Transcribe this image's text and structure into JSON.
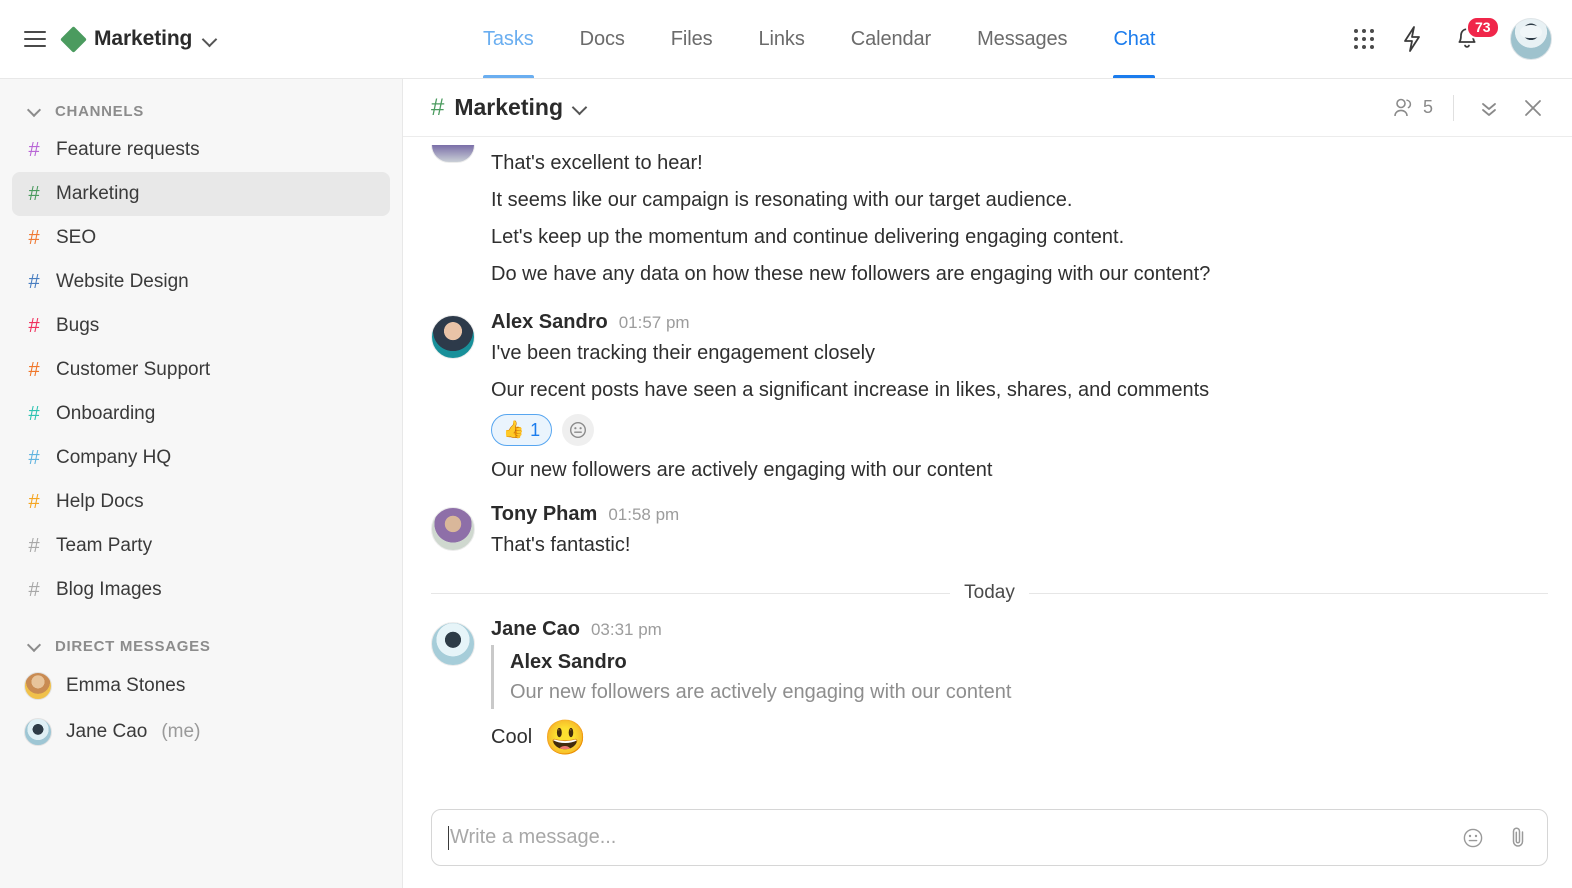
{
  "topbar": {
    "menu_icon": "hamburger-icon",
    "workspace": "Marketing",
    "workspace_caret": "chevron-down-icon",
    "tabs": [
      {
        "label": "Tasks",
        "state": "light"
      },
      {
        "label": "Docs",
        "state": "normal"
      },
      {
        "label": "Files",
        "state": "normal"
      },
      {
        "label": "Links",
        "state": "normal"
      },
      {
        "label": "Calendar",
        "state": "normal"
      },
      {
        "label": "Messages",
        "state": "normal"
      },
      {
        "label": "Chat",
        "state": "active"
      }
    ],
    "apps_icon": "grid-apps-icon",
    "bolt_icon": "lightning-bolt-icon",
    "bell_icon": "bell-icon",
    "notification_count": "73",
    "avatar": "user-avatar"
  },
  "sidebar": {
    "channels_header": "CHANNELS",
    "channels": [
      {
        "name": "Feature requests",
        "color": "#b967d6"
      },
      {
        "name": "Marketing",
        "color": "#4b9b5f",
        "selected": true
      },
      {
        "name": "SEO",
        "color": "#f07a35"
      },
      {
        "name": "Website Design",
        "color": "#4a7fc1"
      },
      {
        "name": "Bugs",
        "color": "#f0325f"
      },
      {
        "name": "Customer Support",
        "color": "#f0772b"
      },
      {
        "name": "Onboarding",
        "color": "#2fc4b2"
      },
      {
        "name": "Company HQ",
        "color": "#62b4e0"
      },
      {
        "name": "Help Docs",
        "color": "#f5a623"
      },
      {
        "name": "Team Party",
        "color": "#a8a8a8"
      },
      {
        "name": "Blog Images",
        "color": "#a8a8a8"
      }
    ],
    "dm_header": "DIRECT MESSAGES",
    "dms": [
      {
        "name": "Emma Stones",
        "tag": "",
        "avatar": "emma"
      },
      {
        "name": "Jane Cao",
        "tag": "(me)",
        "avatar": "jane"
      }
    ]
  },
  "chat": {
    "hash": "#",
    "title": "Marketing",
    "title_caret": "chevron-down-icon",
    "members_icon": "members-icon",
    "member_count": "5",
    "collapse_icon": "double-chevron-down-icon",
    "close_icon": "close-icon",
    "messages": [
      {
        "type": "partial",
        "lines": [
          "That's excellent to hear!",
          "It seems like our campaign is resonating with our target audience.",
          "Let's keep up the momentum and continue delivering engaging content.",
          "Do we have any data on how these new followers are engaging with our content?"
        ]
      },
      {
        "type": "message",
        "author": "Alex Sandro",
        "time": "01:57 pm",
        "avatar": "alex",
        "lines": [
          "I've been tracking their engagement closely",
          "Our recent posts have seen a significant increase in likes, shares, and comments"
        ],
        "reaction": {
          "emoji": "👍",
          "count": "1"
        },
        "add_reaction_icon": "add-reaction-icon",
        "after_lines": [
          "Our new followers are actively engaging with our content"
        ]
      },
      {
        "type": "message",
        "author": "Tony Pham",
        "time": "01:58 pm",
        "avatar": "tony",
        "lines": [
          "That's fantastic!"
        ]
      },
      {
        "type": "divider",
        "label": "Today"
      },
      {
        "type": "message",
        "author": "Jane Cao",
        "time": "03:31 pm",
        "avatar": "jane",
        "quote": {
          "author": "Alex Sandro",
          "text": "Our new followers are actively engaging with our content"
        },
        "cool_text": "Cool",
        "cool_emoji": "😃"
      }
    ]
  },
  "composer": {
    "placeholder": "Write a message...",
    "emoji_icon": "emoji-icon",
    "attach_icon": "paperclip-icon"
  },
  "colors": {
    "accent_blue": "#1b7ced",
    "light_blue": "#6aaef0",
    "green": "#4b9b5f",
    "badge_red": "#f0264a",
    "sidebar_bg": "#f7f7f7",
    "selected_bg": "#e8e8e8"
  }
}
